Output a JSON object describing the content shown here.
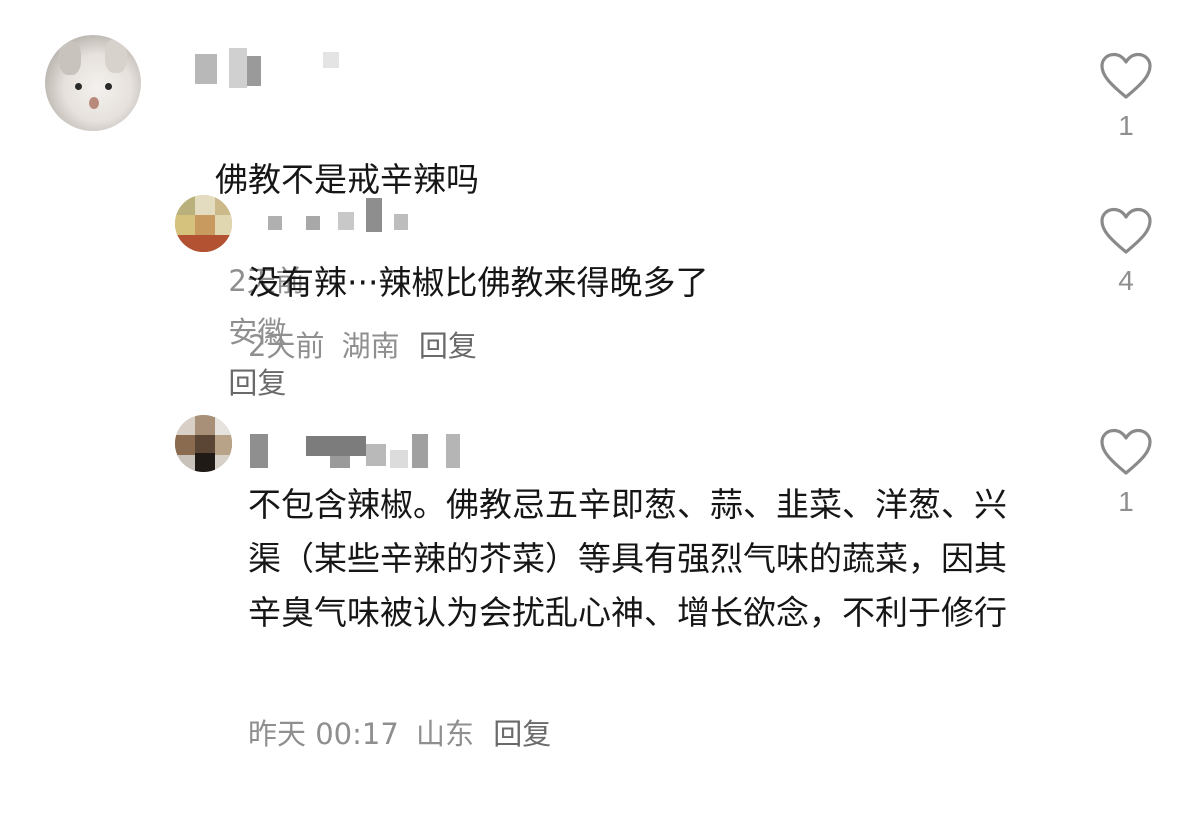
{
  "comments": [
    {
      "text": "佛教不是戒辛辣吗",
      "time": "2天前",
      "location": "安徽",
      "reply_label": "回复",
      "likes": "1"
    },
    {
      "text": "没有辣···辣椒比佛教来得晚多了",
      "time": "2天前",
      "location": "湖南",
      "reply_label": "回复",
      "likes": "4"
    },
    {
      "text": "不包含辣椒。佛教忌五辛即葱、蒜、韭菜、洋葱、兴渠（某些辛辣的芥菜）等具有强烈气味的蔬菜，因其辛臭气味被认为会扰乱心神、增长欲念，不利于修行",
      "time": "昨天 00:17",
      "location": "山东",
      "reply_label": "回复",
      "likes": "1"
    }
  ],
  "colors": {
    "text": "#161616",
    "meta": "#8f8f8f",
    "reply": "#6a6a6a",
    "heart_stroke": "#8a8a8a"
  },
  "icons": {
    "like": "heart-outline-icon"
  }
}
